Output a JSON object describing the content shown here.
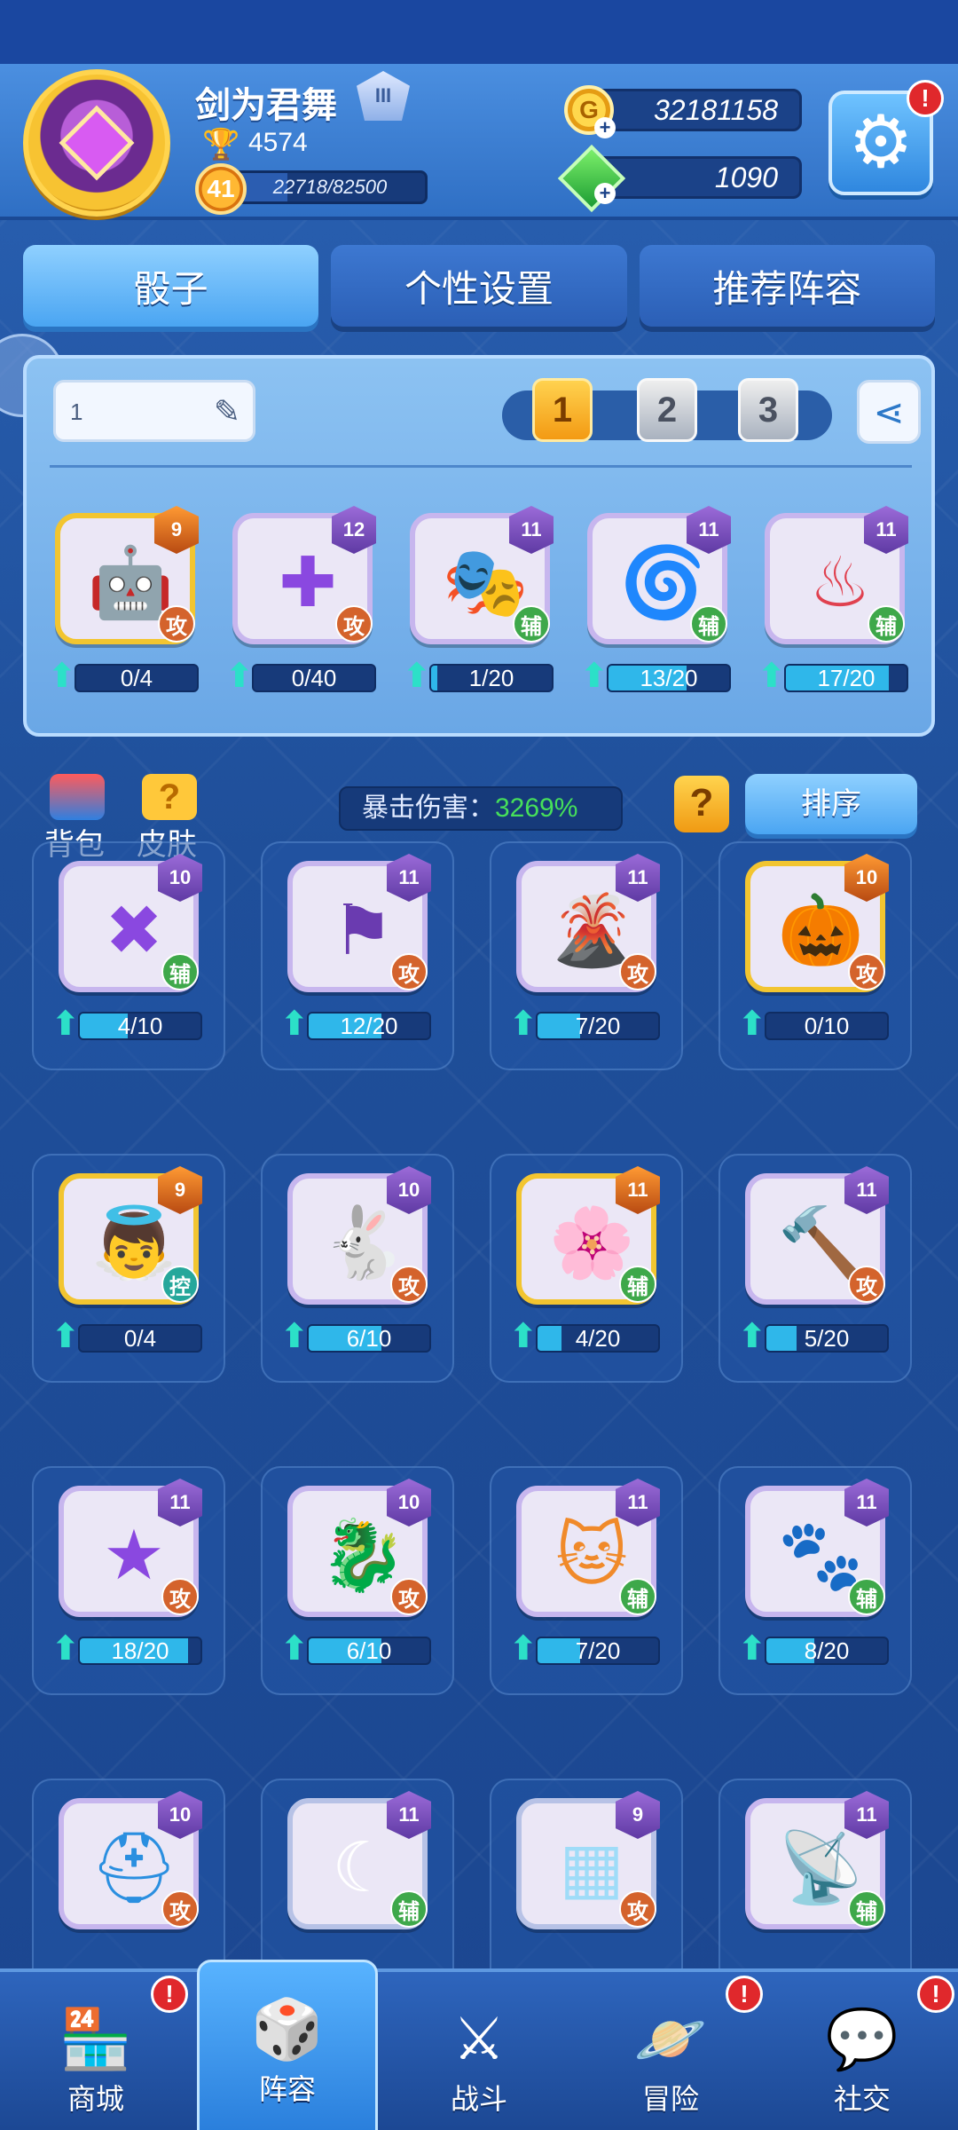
{
  "header": {
    "player_name": "剑为君舞",
    "rank_badge": "III",
    "trophies": "4574",
    "level": "41",
    "xp_text": "22718/82500",
    "xp_progress": 0.275,
    "gold": "32181158",
    "gems": "1090",
    "settings_alert": "!"
  },
  "tabs": [
    {
      "label": "骰子",
      "active": true
    },
    {
      "label": "个性设置",
      "active": false
    },
    {
      "label": "推荐阵容",
      "active": false
    }
  ],
  "deck": {
    "name": "1",
    "slots": [
      "1",
      "2",
      "3"
    ],
    "active_slot": 0,
    "dice": [
      {
        "level": "9",
        "type": "攻",
        "type_key": "atk",
        "frame": "gold",
        "art": "robot-icon",
        "glyph": "🤖",
        "progress": "0/4",
        "ratio": 0.0
      },
      {
        "level": "12",
        "type": "攻",
        "type_key": "atk",
        "frame": "purple",
        "art": "cross-icon",
        "glyph": "✚",
        "progress": "0/40",
        "ratio": 0.0
      },
      {
        "level": "11",
        "type": "辅",
        "type_key": "sup",
        "frame": "purple",
        "art": "mask-icon",
        "glyph": "🎭",
        "progress": "1/20",
        "ratio": 0.05
      },
      {
        "level": "11",
        "type": "辅",
        "type_key": "sup",
        "frame": "purple",
        "art": "vortex-icon",
        "glyph": "🌀",
        "progress": "13/20",
        "ratio": 0.65
      },
      {
        "level": "11",
        "type": "辅",
        "type_key": "sup",
        "frame": "purple",
        "art": "flame-chest-icon",
        "glyph": "♨",
        "progress": "17/20",
        "ratio": 0.85
      }
    ]
  },
  "toolbar": {
    "bag_label": "背包",
    "skin_label": "皮肤",
    "crit_label": "暴击伤害：",
    "crit_value": "3269%",
    "help_label": "?",
    "sort_label": "排序"
  },
  "collection": [
    {
      "level": "10",
      "type": "辅",
      "type_key": "sup",
      "frame": "purple",
      "art": "axes-icon",
      "glyph": "✖",
      "progress": "4/10",
      "ratio": 0.4
    },
    {
      "level": "11",
      "type": "攻",
      "type_key": "atk",
      "frame": "purple",
      "art": "banner-icon",
      "glyph": "⚑",
      "progress": "12/20",
      "ratio": 0.6
    },
    {
      "level": "11",
      "type": "攻",
      "type_key": "atk",
      "frame": "purple",
      "art": "volcano-icon",
      "glyph": "🌋",
      "progress": "7/20",
      "ratio": 0.35
    },
    {
      "level": "10",
      "type": "攻",
      "type_key": "atk",
      "frame": "gold",
      "art": "pumpkin-witch-icon",
      "glyph": "🎃",
      "progress": "0/10",
      "ratio": 0.0
    },
    {
      "level": "9",
      "type": "控",
      "type_key": "ctl",
      "frame": "gold",
      "art": "angel-wings-icon",
      "glyph": "👼",
      "progress": "0/4",
      "ratio": 0.0
    },
    {
      "level": "10",
      "type": "攻",
      "type_key": "atk",
      "frame": "purple",
      "art": "rabbit-icon",
      "glyph": "🐇",
      "progress": "6/10",
      "ratio": 0.6
    },
    {
      "level": "11",
      "type": "辅",
      "type_key": "sup",
      "frame": "gold",
      "art": "sakura-icon",
      "glyph": "🌸",
      "progress": "4/20",
      "ratio": 0.2
    },
    {
      "level": "11",
      "type": "攻",
      "type_key": "atk",
      "frame": "purple",
      "art": "hammer-icon",
      "glyph": "🔨",
      "progress": "5/20",
      "ratio": 0.25
    },
    {
      "level": "11",
      "type": "攻",
      "type_key": "atk",
      "frame": "purple",
      "art": "stars-icon",
      "glyph": "★",
      "progress": "18/20",
      "ratio": 0.9
    },
    {
      "level": "10",
      "type": "攻",
      "type_key": "atk",
      "frame": "purple",
      "art": "dragon-icon",
      "glyph": "🐉",
      "progress": "6/10",
      "ratio": 0.6
    },
    {
      "level": "11",
      "type": "辅",
      "type_key": "sup",
      "frame": "purple",
      "art": "lucky-cat-icon",
      "glyph": "🐱",
      "progress": "7/20",
      "ratio": 0.35
    },
    {
      "level": "11",
      "type": "辅",
      "type_key": "sup",
      "frame": "purple",
      "art": "paw-icon",
      "glyph": "🐾",
      "progress": "8/20",
      "ratio": 0.4
    },
    {
      "level": "10",
      "type": "攻",
      "type_key": "atk",
      "frame": "purple",
      "art": "helmet-icon",
      "glyph": "⛑",
      "progress": "",
      "ratio": 0.0
    },
    {
      "level": "11",
      "type": "辅",
      "type_key": "sup",
      "frame": "silver",
      "art": "moon-icon",
      "glyph": "☾",
      "progress": "",
      "ratio": 0.0
    },
    {
      "level": "9",
      "type": "攻",
      "type_key": "atk",
      "frame": "silver",
      "art": "tiles-icon",
      "glyph": "▦",
      "progress": "",
      "ratio": 0.0
    },
    {
      "level": "11",
      "type": "辅",
      "type_key": "sup",
      "frame": "purple",
      "art": "signal-icon",
      "glyph": "📡",
      "progress": "",
      "ratio": 0.0
    }
  ],
  "bottom_nav": [
    {
      "label": "商城",
      "icon": "shop-icon",
      "glyph": "🏪",
      "alert": "!",
      "active": false
    },
    {
      "label": "阵容",
      "icon": "dice-icon",
      "glyph": "🎲",
      "alert": "",
      "active": true
    },
    {
      "label": "战斗",
      "icon": "swords-icon",
      "glyph": "⚔",
      "alert": "",
      "active": false
    },
    {
      "label": "冒险",
      "icon": "planet-icon",
      "glyph": "🪐",
      "alert": "!",
      "active": false
    },
    {
      "label": "社交",
      "icon": "chat-icon",
      "glyph": "💬",
      "alert": "!",
      "active": false
    }
  ],
  "colors": {
    "accent": "#4aa5f2",
    "gold": "#ffd44e",
    "crit_green": "#46e05a",
    "alert_red": "#e0282c"
  }
}
